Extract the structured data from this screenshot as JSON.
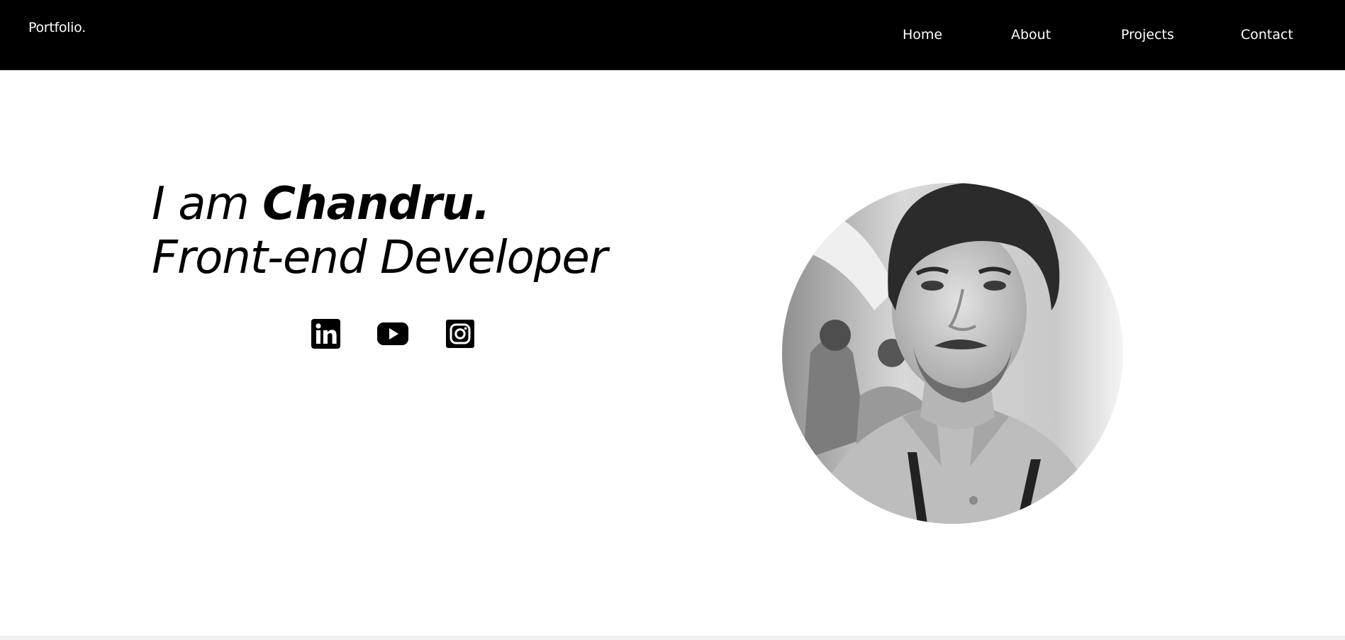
{
  "header": {
    "brand": "Portfolio.",
    "nav": [
      {
        "label": "Home"
      },
      {
        "label": "About"
      },
      {
        "label": "Projects"
      },
      {
        "label": "Contact"
      }
    ]
  },
  "hero": {
    "intro": "I am ",
    "name": "Chandru.",
    "role": "Front-end Developer"
  },
  "social": {
    "icons": [
      "linkedin-icon",
      "youtube-icon",
      "instagram-icon"
    ]
  },
  "colors": {
    "header_bg": "#000000",
    "header_text": "#ffffff",
    "page_bg": "#ffffff",
    "text": "#000000"
  }
}
